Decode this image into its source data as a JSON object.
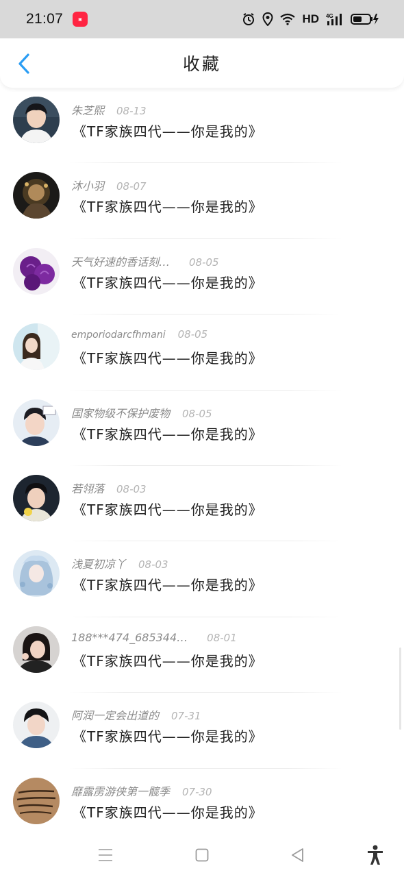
{
  "status_bar": {
    "time": "21:07",
    "app_badge": "小红书",
    "network": "HD",
    "signal_label": "4G"
  },
  "header": {
    "title": "收藏",
    "back_icon": "chevron-left-icon"
  },
  "colors": {
    "accent": "#2a9df4",
    "name_text": "#8a8a8a",
    "date_text": "#b4b4b4",
    "title_text": "#222222",
    "status_bg": "#d9d9d9"
  },
  "items": [
    {
      "name": "朱芝熙",
      "date": "08-13",
      "title": "《TF家族四代——你是我的》"
    },
    {
      "name": "沐小羽",
      "date": "08-07",
      "title": "《TF家族四代——你是我的》"
    },
    {
      "name": "天气好速的香话刻…",
      "date": "08-05",
      "title": "《TF家族四代——你是我的》"
    },
    {
      "name": "emporiodarcfhmani",
      "date": "08-05",
      "title": "《TF家族四代——你是我的》"
    },
    {
      "name": "国家物级不保护废物",
      "date": "08-05",
      "title": "《TF家族四代——你是我的》"
    },
    {
      "name": "若翎落",
      "date": "08-03",
      "title": "《TF家族四代——你是我的》"
    },
    {
      "name": "浅夏初凉丫",
      "date": "08-03",
      "title": "《TF家族四代——你是我的》"
    },
    {
      "name": "188***474_685344…",
      "date": "08-01",
      "title": "《TF家族四代——你是我的》"
    },
    {
      "name": "阿润一定会出道的",
      "date": "07-31",
      "title": "《TF家族四代——你是我的》"
    },
    {
      "name": "靡露雳游侠第一髋季",
      "date": "07-30",
      "title": "《TF家族四代——你是我的》"
    }
  ],
  "nav_bar": {
    "menu_icon": "menu-icon",
    "home_icon": "square-home-icon",
    "back_icon": "triangle-back-icon",
    "accessibility_icon": "accessibility-icon"
  }
}
